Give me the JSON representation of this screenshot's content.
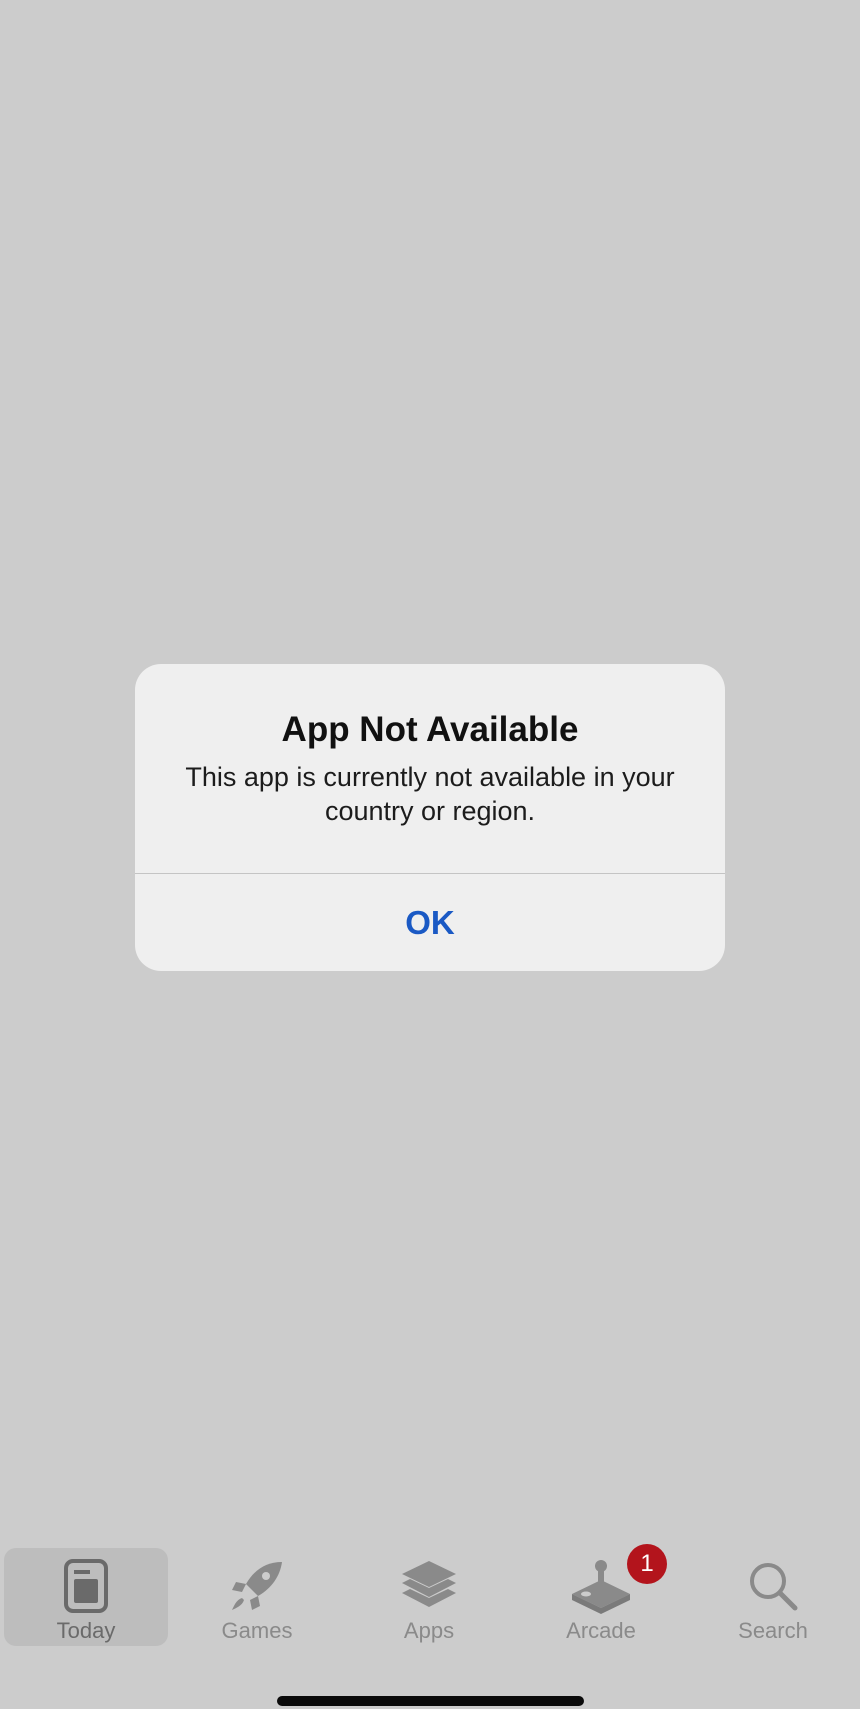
{
  "alert": {
    "title": "App Not Available",
    "message": "This app is currently not available in your country or region.",
    "ok_label": "OK"
  },
  "tabbar": {
    "active_tab": "Today",
    "tabs": [
      {
        "label": "Today",
        "icon": "today-icon"
      },
      {
        "label": "Games",
        "icon": "rocket-icon"
      },
      {
        "label": "Apps",
        "icon": "stack-icon"
      },
      {
        "label": "Arcade",
        "icon": "joystick-icon",
        "badge": "1"
      },
      {
        "label": "Search",
        "icon": "search-icon"
      }
    ]
  },
  "colors": {
    "background": "#cccccc",
    "alert_bg": "#efefef",
    "accent": "#1a59c4",
    "badge": "#b3141c",
    "tab_inactive": "#8a8a8a"
  }
}
